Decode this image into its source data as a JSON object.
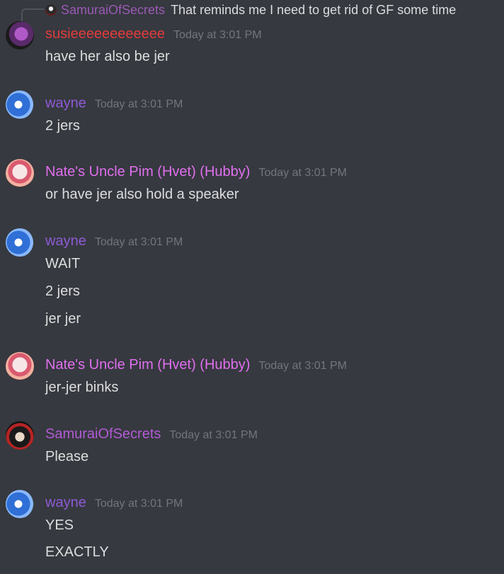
{
  "colors": {
    "background": "#36393f",
    "text": "#dcddde",
    "timestamp": "#72767d",
    "susie": "#e03c3c",
    "wayne": "#8e5ad6",
    "pim": "#e16ef0",
    "samurai": "#b35ad6"
  },
  "reply": {
    "author": "SamuraiOfSecrets",
    "text": "That reminds me I need to get rid of GF some time",
    "avatar_icon": "samurai-avatar-icon"
  },
  "groups": [
    {
      "author": "susieeeeeeeeeeee",
      "timestamp": "Today at 3:01 PM",
      "messages": [
        "have her also be jer"
      ]
    },
    {
      "author": "wayne",
      "timestamp": "Today at 3:01 PM",
      "messages": [
        "2 jers"
      ]
    },
    {
      "author": "Nate's Uncle Pim (Hvet) (Hubby)",
      "timestamp": "Today at 3:01 PM",
      "messages": [
        "or have jer also hold a speaker"
      ]
    },
    {
      "author": "wayne",
      "timestamp": "Today at 3:01 PM",
      "messages": [
        "WAIT",
        "2 jers",
        "jer jer"
      ]
    },
    {
      "author": "Nate's Uncle Pim (Hvet) (Hubby)",
      "timestamp": "Today at 3:01 PM",
      "messages": [
        "jer-jer binks"
      ]
    },
    {
      "author": "SamuraiOfSecrets",
      "timestamp": "Today at 3:01 PM",
      "messages": [
        "Please"
      ]
    },
    {
      "author": "wayne",
      "timestamp": "Today at 3:01 PM",
      "messages": [
        "YES",
        "EXACTLY"
      ]
    }
  ]
}
